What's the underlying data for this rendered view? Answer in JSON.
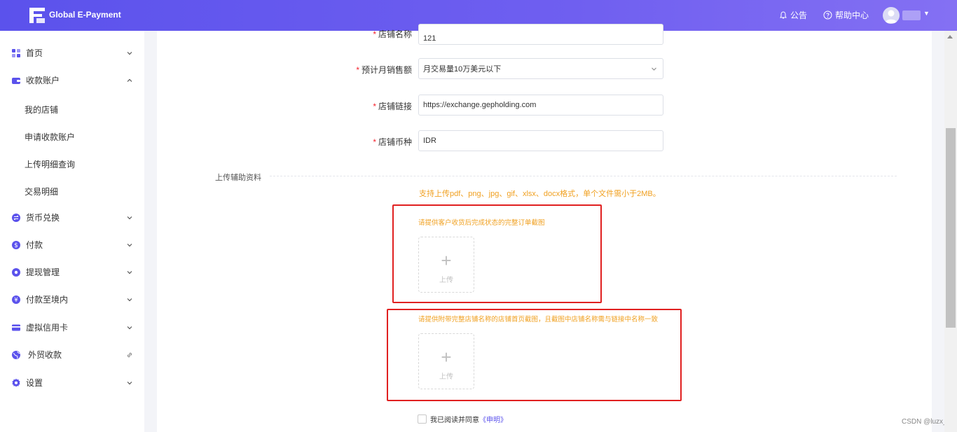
{
  "header": {
    "brand": "Global E-Payment",
    "announcement": "公告",
    "help_center": "帮助中心"
  },
  "sidebar": {
    "items": [
      {
        "label": "首页",
        "icon": "grid-icon",
        "chevron": "down"
      },
      {
        "label": "收款账户",
        "icon": "wallet-icon",
        "chevron": "up",
        "children": [
          "我的店铺",
          "申请收款账户",
          "上传明细查询",
          "交易明细"
        ]
      },
      {
        "label": "货币兑换",
        "icon": "exchange-icon",
        "chevron": "down"
      },
      {
        "label": "付款",
        "icon": "dollar-coin-icon",
        "chevron": "down"
      },
      {
        "label": "提现管理",
        "icon": "withdraw-icon",
        "chevron": "down"
      },
      {
        "label": "付款至境内",
        "icon": "yuan-coin-icon",
        "chevron": "down"
      },
      {
        "label": "虚拟信用卡",
        "icon": "credit-card-icon",
        "chevron": "down"
      },
      {
        "label": "外贸收款",
        "icon": "globe-icon",
        "chevron": "link"
      },
      {
        "label": "设置",
        "icon": "gear-icon",
        "chevron": "down"
      }
    ]
  },
  "form": {
    "store_name": {
      "label": "店铺名称",
      "value": "121"
    },
    "monthly_sales": {
      "label": "预计月销售额",
      "value": "月交易量10万美元以下"
    },
    "store_link": {
      "label": "店铺链接",
      "value": "https://exchange.gepholding.com"
    },
    "store_currency": {
      "label": "店铺币种",
      "value": "IDR"
    },
    "required_mark": "*"
  },
  "upload_section": {
    "title": "上传辅助资料",
    "hint": "支持上传pdf、png、jpg、gif、xlsx、docx格式，单个文件需小于2MB。",
    "uploads": [
      {
        "title": "请提供客户收货后完成状态的完整订单截图",
        "button": "上传"
      },
      {
        "title": "请提供附带完整店铺名称的店铺首页截图，且截图中店铺名称需与链接中名称一致",
        "button": "上传"
      }
    ]
  },
  "agreement": {
    "text": "我已阅读并同意",
    "link": "《申明》"
  },
  "watermark": "CSDN @luzx_",
  "colors": {
    "header_start": "#5b52ec",
    "header_end": "#8470f3",
    "accent": "#5b52ec",
    "hint": "#f0a020",
    "required": "#f5222d",
    "highlight_frame": "#e02020"
  }
}
